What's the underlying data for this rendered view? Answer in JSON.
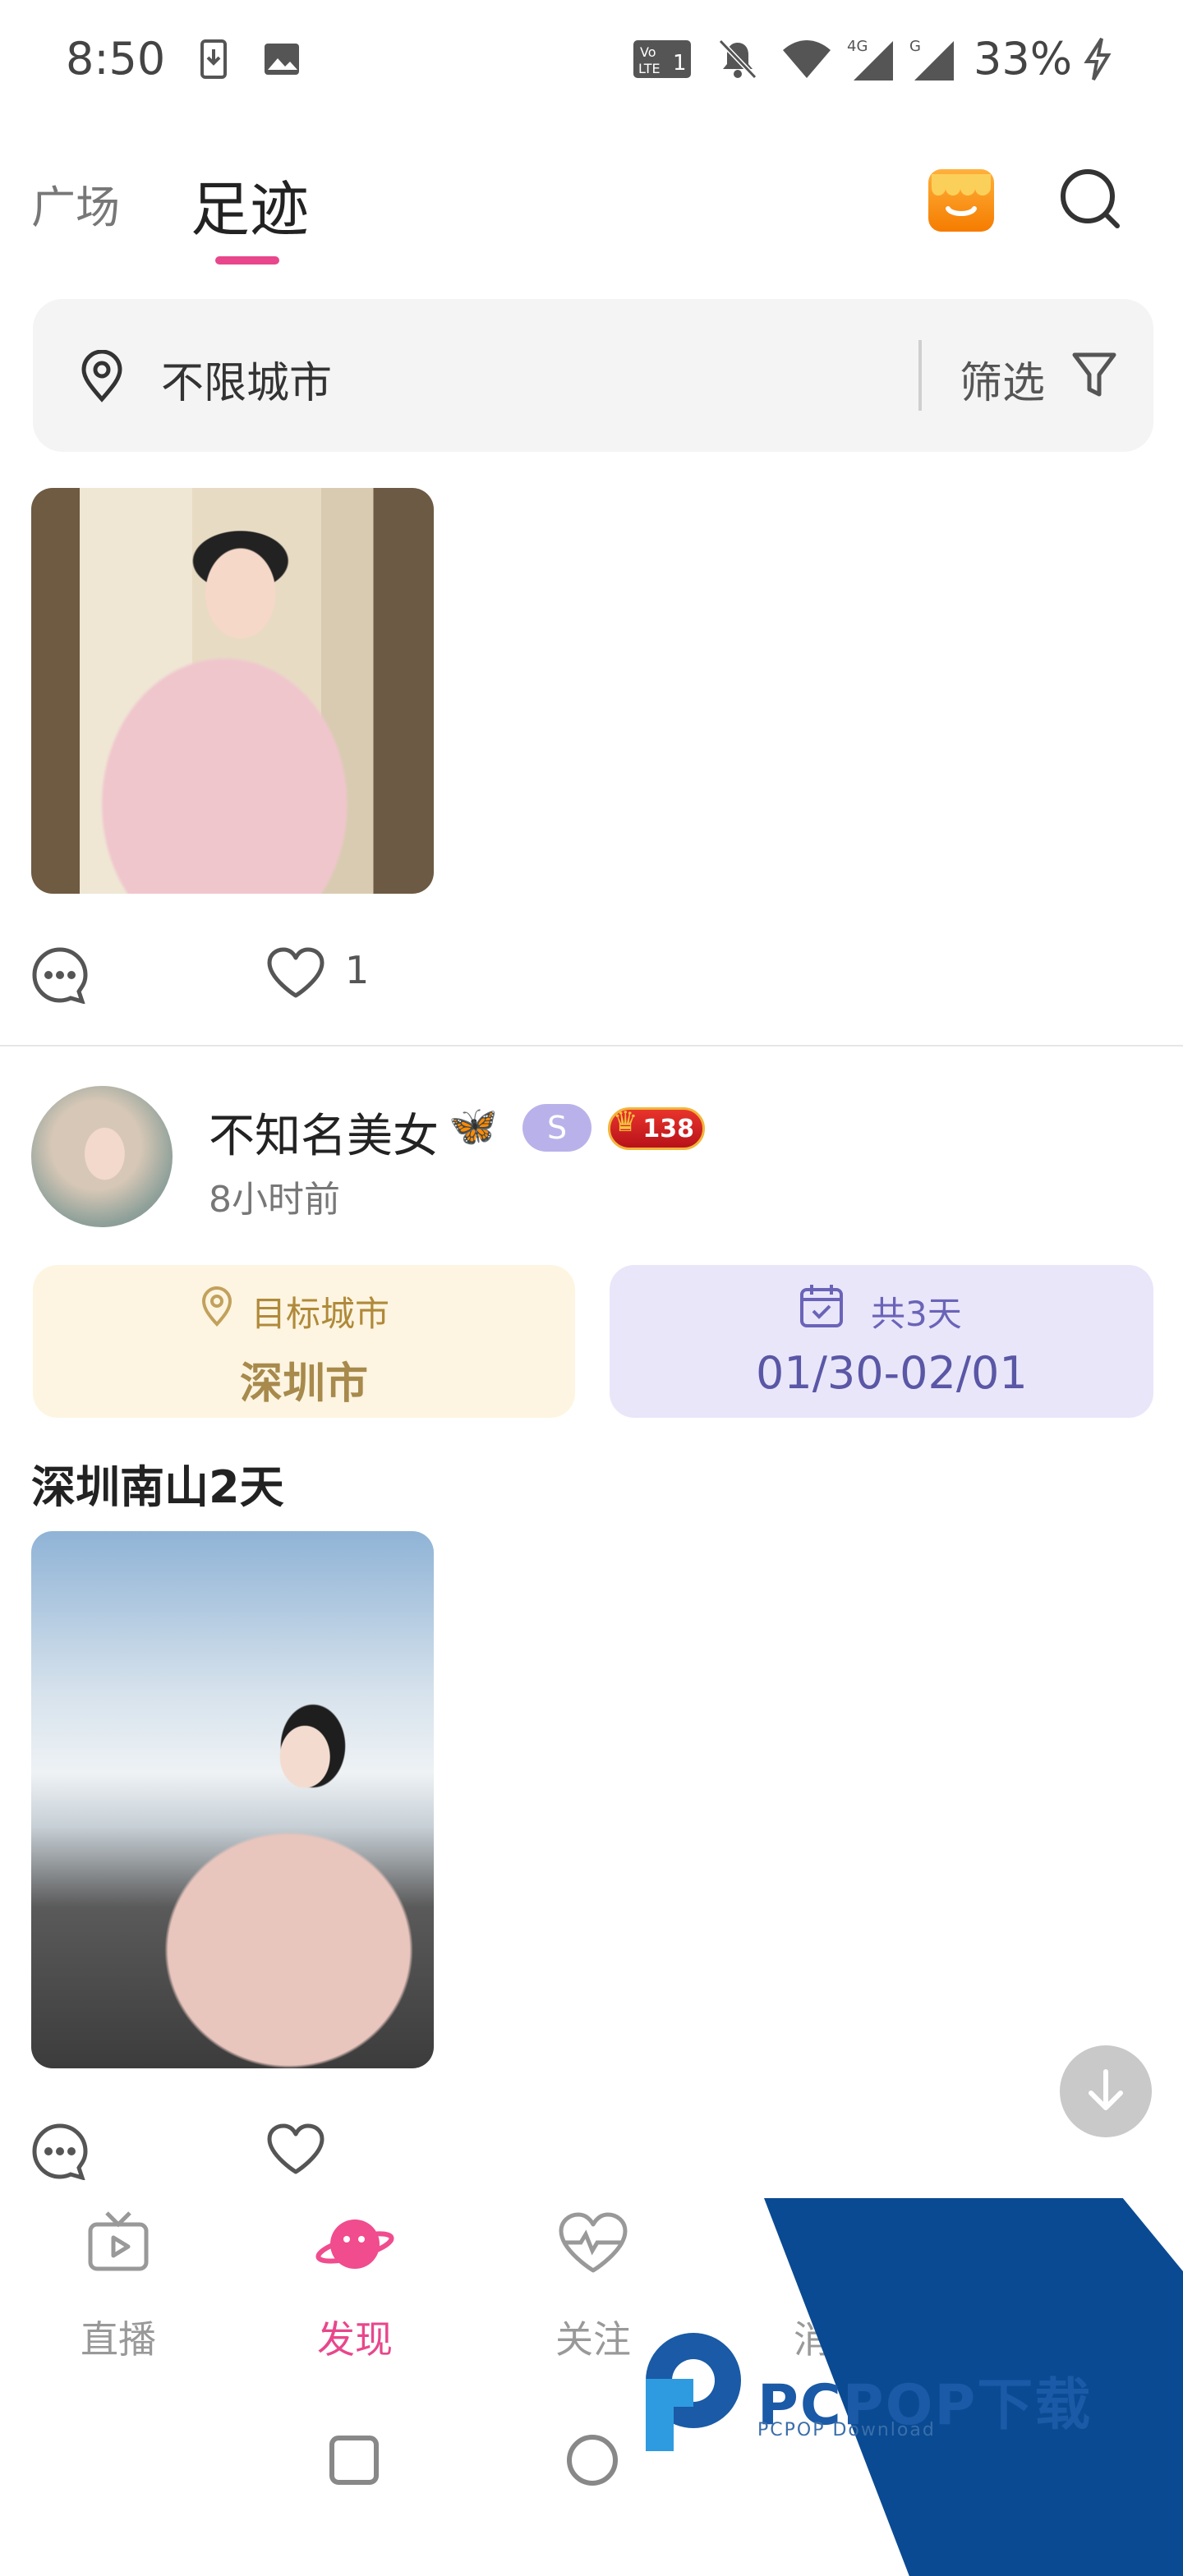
{
  "status_bar": {
    "time": "8:50",
    "battery": "33%",
    "icons": [
      "download-icon",
      "image-icon",
      "volte-icon",
      "mute-icon",
      "wifi-icon",
      "signal-4g-icon",
      "signal-g-icon",
      "charging-icon"
    ]
  },
  "top_tabs": [
    {
      "label": "广场",
      "active": false
    },
    {
      "label": "足迹",
      "active": true
    }
  ],
  "filter_bar": {
    "city": "不限城市",
    "filter_label": "筛选"
  },
  "first_post": {
    "like_count": "1"
  },
  "post": {
    "username": "不知名美女",
    "emoji": "🦋",
    "badge_s": "S",
    "level": "138",
    "time": "8小时前",
    "target_city_label": "目标城市",
    "target_city": "深圳市",
    "days_label": "共3天",
    "dates": "01/30-02/01",
    "title": "深圳南山2天"
  },
  "bottom_nav": [
    {
      "label": "直播",
      "icon": "tv-icon",
      "active": false
    },
    {
      "label": "发现",
      "icon": "planet-icon",
      "active": true
    },
    {
      "label": "关注",
      "icon": "heartbeat-icon",
      "active": false
    },
    {
      "label": "消息",
      "icon": "message-icon",
      "active": false
    }
  ],
  "watermark": {
    "brand": "PCPOP下载",
    "sub": "PCPOP Download"
  },
  "colors": {
    "accent": "#e8478b",
    "city_card": "#fdf5e1",
    "date_card": "#e9e6fa"
  }
}
